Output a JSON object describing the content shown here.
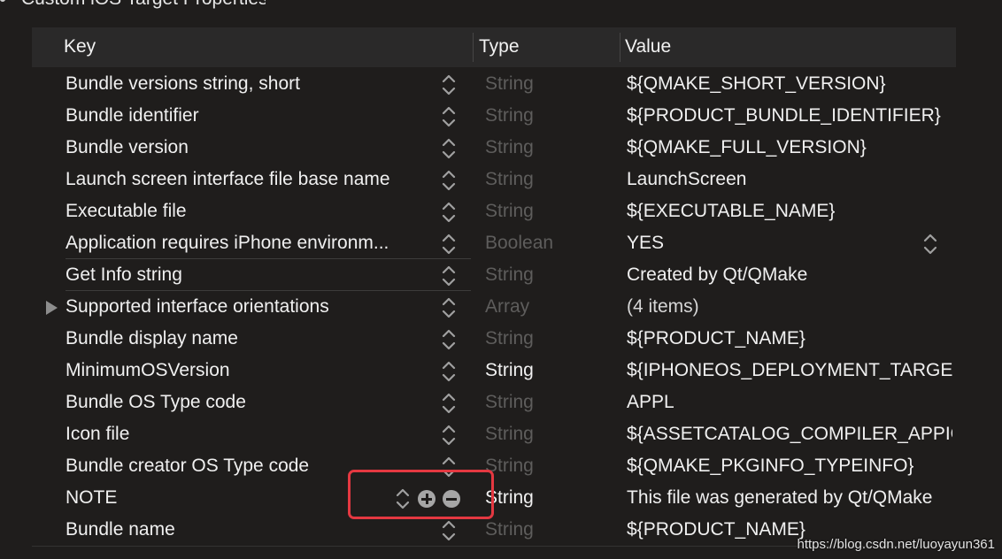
{
  "section_heading": "Custom iOS Target Properties",
  "header": {
    "key": "Key",
    "type": "Type",
    "value": "Value"
  },
  "rows": [
    {
      "key": "Bundle versions string, short",
      "type": "String",
      "value": "${QMAKE_SHORT_VERSION}"
    },
    {
      "key": "Bundle identifier",
      "type": "String",
      "value": "${PRODUCT_BUNDLE_IDENTIFIER}"
    },
    {
      "key": "Bundle version",
      "type": "String",
      "value": "${QMAKE_FULL_VERSION}"
    },
    {
      "key": "Launch screen interface file base name",
      "type": "String",
      "value": "LaunchScreen"
    },
    {
      "key": "Executable file",
      "type": "String",
      "value": "${EXECUTABLE_NAME}"
    },
    {
      "key": "Application requires iPhone environm...",
      "type": "Boolean",
      "value": "YES"
    },
    {
      "key": "Get Info string",
      "type": "String",
      "value": "Created by Qt/QMake"
    },
    {
      "key": "Supported interface orientations",
      "type": "Array",
      "value": "(4 items)"
    },
    {
      "key": "Bundle display name",
      "type": "String",
      "value": "${PRODUCT_NAME}"
    },
    {
      "key": "MinimumOSVersion",
      "type": "String",
      "value": "${IPHONEOS_DEPLOYMENT_TARGET}"
    },
    {
      "key": "Bundle OS Type code",
      "type": "String",
      "value": "APPL"
    },
    {
      "key": "Icon file",
      "type": "String",
      "value": "${ASSETCATALOG_COMPILER_APPICON_NAME}"
    },
    {
      "key": "Bundle creator OS Type code",
      "type": "String",
      "value": "${QMAKE_PKGINFO_TYPEINFO}"
    },
    {
      "key": "NOTE",
      "type": "String",
      "value": "This file was generated by Qt/QMake"
    },
    {
      "key": "Bundle name",
      "type": "String",
      "value": "${PRODUCT_NAME}"
    }
  ],
  "watermark": "https://blog.csdn.net/luoyayun361"
}
